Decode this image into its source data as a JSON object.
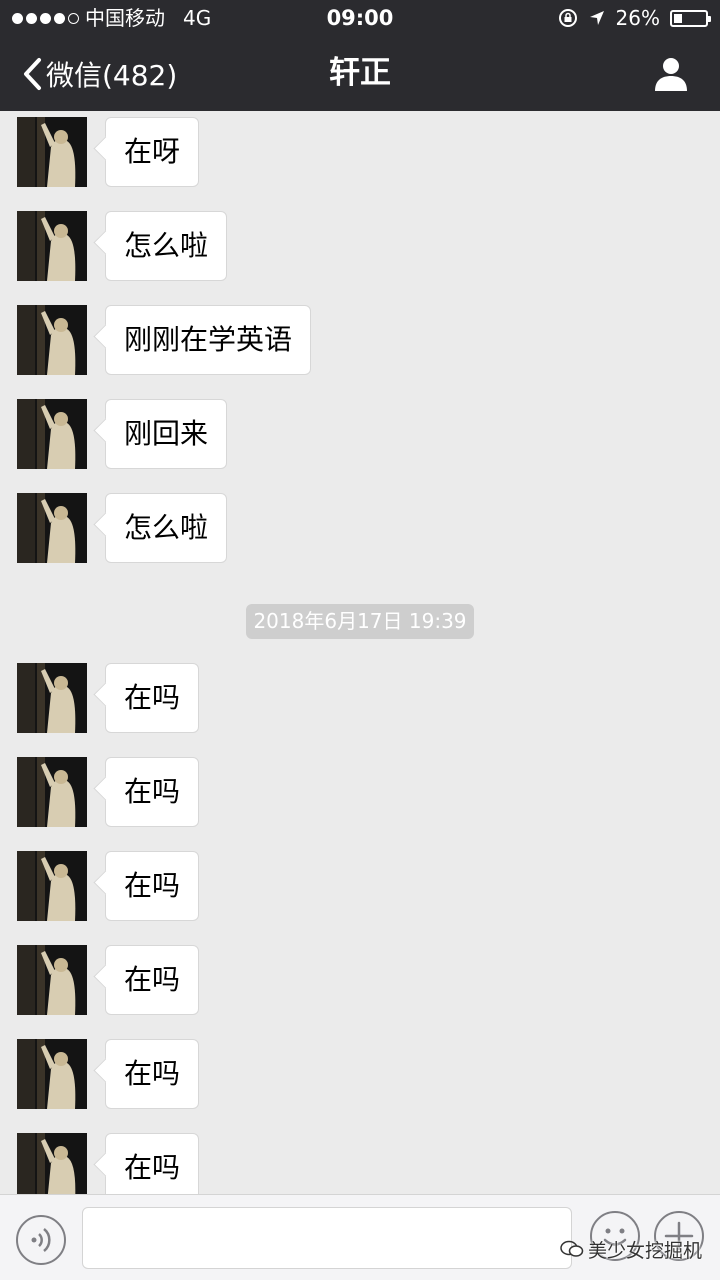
{
  "status_bar": {
    "carrier": "中国移动",
    "network": "4G",
    "time": "09:00",
    "battery_percent": "26%",
    "battery_level": 0.26
  },
  "nav": {
    "back_label": "微信(482)",
    "title": "轩正"
  },
  "messages_before": [
    {
      "text": "在呀"
    },
    {
      "text": "怎么啦"
    },
    {
      "text": "刚刚在学英语"
    },
    {
      "text": "刚回来"
    },
    {
      "text": "怎么啦"
    }
  ],
  "timestamp": "2018年6月17日 19:39",
  "messages_after": [
    {
      "text": "在吗"
    },
    {
      "text": "在吗"
    },
    {
      "text": "在吗"
    },
    {
      "text": "在吗"
    },
    {
      "text": "在吗"
    },
    {
      "text": "在吗"
    }
  ],
  "input": {
    "value": "",
    "placeholder": ""
  },
  "watermark": "美少女挖掘机",
  "icons": {
    "back": "chevron-left-icon",
    "profile": "person-icon",
    "voice": "voice-icon",
    "emoji": "smiley-icon",
    "plus": "plus-icon"
  },
  "colors": {
    "nav_bg": "#2b2b2f",
    "chat_bg": "#ebebeb",
    "bubble_bg": "#ffffff",
    "timestamp_bg": "#cecece"
  }
}
